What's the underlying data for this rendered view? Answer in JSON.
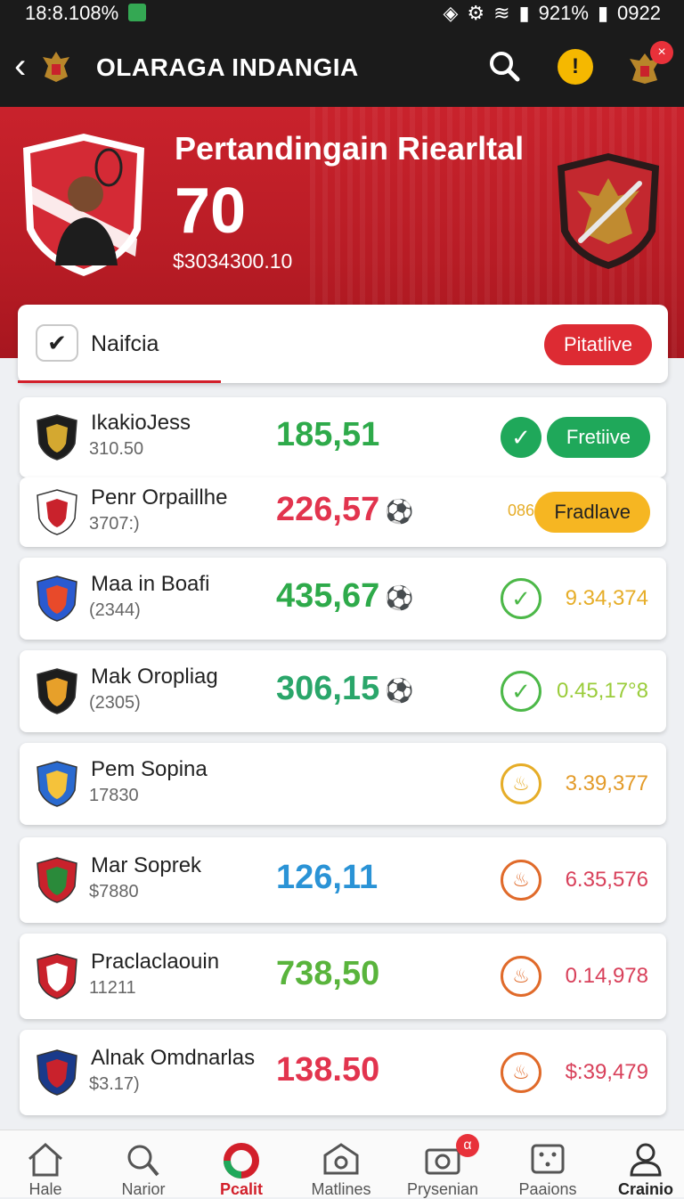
{
  "status": {
    "left": "18:8.108%",
    "right_pct": "921%",
    "right_time": "0922"
  },
  "appbar": {
    "title": "OLARAGA INDANGIA",
    "badge": "×"
  },
  "hero": {
    "title": "Pertandingain Riearltal",
    "score": "70",
    "amount": "$3034300.10"
  },
  "tab": {
    "label": "Naifcia",
    "pill": "Pitatlive"
  },
  "rows": [
    {
      "name": "IkakioJess",
      "sub": "310.50",
      "score": "185,51",
      "score_color": "#2eaa4a",
      "ball": "",
      "check": "filled",
      "btn": "Fretiive",
      "btn_bg": "#1fa85a",
      "btn_fg": "#ffffff",
      "extra": ""
    },
    {
      "name": "Penr Orpaillhe",
      "sub": "3707:)",
      "score": "226,57",
      "score_color": "#e2344e",
      "ball": "⚽",
      "check": "",
      "btn": "Fradlave",
      "btn_bg": "#f6b622",
      "btn_fg": "#222222",
      "extra": "0865"
    },
    {
      "name": "Maa in Boafi",
      "sub": "(2344)",
      "score": "435,67",
      "score_color": "#2eaa4a",
      "ball": "⚽",
      "check": "outline",
      "val": "9.34,374",
      "val_color": "#e6ad28"
    },
    {
      "name": "Mak Oropliag",
      "sub": "(2305)",
      "score": "306,15",
      "score_color": "#2aa66a",
      "ball": "⚽",
      "check": "outline",
      "val": "0.45,17°8",
      "val_color": "#9acc3a"
    },
    {
      "name": "Pem Sopina",
      "sub": "17830",
      "score": "",
      "score_color": "#222222",
      "ball": "",
      "check": "fire",
      "val": "3.39,377",
      "val_color": "#e39b2a"
    },
    {
      "name": "Mar Soprek",
      "sub": "$7880",
      "score": "126,11",
      "score_color": "#2a93d6",
      "ball": "",
      "check": "fire",
      "val": "6.35,576",
      "val_color": "#d8405a"
    },
    {
      "name": "Praclaclaouin",
      "sub": "11211",
      "score": "738,50",
      "score_color": "#59b43c",
      "ball": "",
      "check": "fire",
      "val": "0.14,978",
      "val_color": "#d8405a"
    },
    {
      "name": "Alnak Omdnarlas",
      "sub": "$3.17)",
      "score": "138.50",
      "score_color": "#e2344e",
      "ball": "",
      "check": "fire",
      "val": "$:39,479",
      "val_color": "#d8405a"
    }
  ],
  "nav": {
    "items": [
      {
        "label": "Hale"
      },
      {
        "label": "Narior"
      },
      {
        "label": "Pcalit"
      },
      {
        "label": "Matlines"
      },
      {
        "label": "Prysenian"
      },
      {
        "label": "Paaions"
      },
      {
        "label": "Crainio"
      }
    ],
    "badge": "α"
  }
}
